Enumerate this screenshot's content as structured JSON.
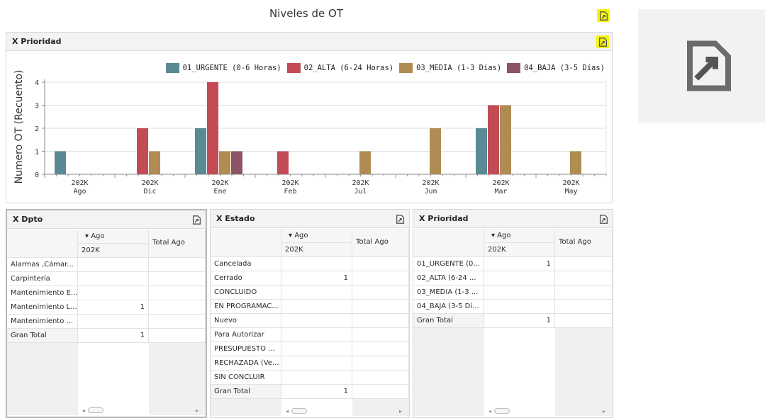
{
  "dashboard": {
    "title": "Niveles de OT"
  },
  "icons": {
    "export": "export-to-file-icon",
    "scroll_left": "◂",
    "scroll_right": "▸"
  },
  "colors": {
    "urgente": "#5a8a94",
    "alta": "#c34b55",
    "media": "#b08c53",
    "baja": "#8c5566",
    "highlight": "#f5f50a"
  },
  "chart_panel": {
    "title": "X Prioridad"
  },
  "chart_data": {
    "type": "bar",
    "ylabel": "Numero OT (Recuento)",
    "ylim": [
      0,
      4
    ],
    "yticks": [
      "0",
      "1",
      "2",
      "3",
      "4"
    ],
    "categories": [
      {
        "line1": "202K",
        "line2": "Ago"
      },
      {
        "line1": "202K",
        "line2": "Dic"
      },
      {
        "line1": "202K",
        "line2": "Ene"
      },
      {
        "line1": "202K",
        "line2": "Feb"
      },
      {
        "line1": "202K",
        "line2": "Jul"
      },
      {
        "line1": "202K",
        "line2": "Jun"
      },
      {
        "line1": "202K",
        "line2": "Mar"
      },
      {
        "line1": "202K",
        "line2": "May"
      }
    ],
    "series": [
      {
        "name": "01_URGENTE (0-6 Horas)",
        "color": "#5a8a94",
        "values": [
          1,
          0,
          2,
          0,
          0,
          0,
          2,
          0
        ]
      },
      {
        "name": "02_ALTA (6-24 Horas)",
        "color": "#c34b55",
        "values": [
          0,
          2,
          4,
          1,
          0,
          0,
          3,
          0
        ]
      },
      {
        "name": "03_MEDIA (1-3 Días)",
        "color": "#b08c53",
        "values": [
          0,
          1,
          1,
          0,
          1,
          2,
          3,
          1
        ]
      },
      {
        "name": "04_BAJA (3-5 Días)",
        "color": "#8c5566",
        "values": [
          0,
          0,
          1,
          0,
          0,
          0,
          0,
          0
        ]
      }
    ],
    "grid": true,
    "legend": "top-right"
  },
  "pivots": [
    {
      "title": "X Dpto",
      "col_sort": "▾ Ago",
      "col_sub": "202K",
      "total_col": "Total Ago",
      "rows": [
        {
          "label": "Alarmas ,Cámar...",
          "value": "",
          "total": ""
        },
        {
          "label": "Carpintería",
          "value": "",
          "total": ""
        },
        {
          "label": "Mantenimiento E...",
          "value": "",
          "total": ""
        },
        {
          "label": "Mantenimiento L...",
          "value": "1",
          "total": ""
        },
        {
          "label": "Mantenimiento ...",
          "value": "",
          "total": ""
        },
        {
          "label": "Gran Total",
          "value": "1",
          "total": ""
        }
      ]
    },
    {
      "title": "X Estado",
      "col_sort": "▾ Ago",
      "col_sub": "202K",
      "total_col": "Total Ago",
      "rows": [
        {
          "label": "Cancelada",
          "value": "",
          "total": ""
        },
        {
          "label": "Cerrado",
          "value": "1",
          "total": ""
        },
        {
          "label": "CONCLUIDO",
          "value": "",
          "total": ""
        },
        {
          "label": "EN PROGRAMAC...",
          "value": "",
          "total": ""
        },
        {
          "label": "Nuevo",
          "value": "",
          "total": ""
        },
        {
          "label": "Para Autorizar",
          "value": "",
          "total": ""
        },
        {
          "label": "PRESUPUESTO ...",
          "value": "",
          "total": ""
        },
        {
          "label": "RECHAZADA (Ve...",
          "value": "",
          "total": ""
        },
        {
          "label": "SIN CONCLUIR",
          "value": "",
          "total": ""
        },
        {
          "label": "Gran Total",
          "value": "1",
          "total": ""
        }
      ]
    },
    {
      "title": "X Prioridad",
      "col_sort": "▾ Ago",
      "col_sub": "202K",
      "total_col": "Total Ago",
      "rows": [
        {
          "label": "01_URGENTE (0...",
          "value": "1",
          "total": ""
        },
        {
          "label": "02_ALTA (6-24 ...",
          "value": "",
          "total": ""
        },
        {
          "label": "03_MEDIA (1-3 ...",
          "value": "",
          "total": ""
        },
        {
          "label": "04_BAJA (3-5 Dí...",
          "value": "",
          "total": ""
        },
        {
          "label": "Gran Total",
          "value": "1",
          "total": ""
        }
      ]
    }
  ]
}
